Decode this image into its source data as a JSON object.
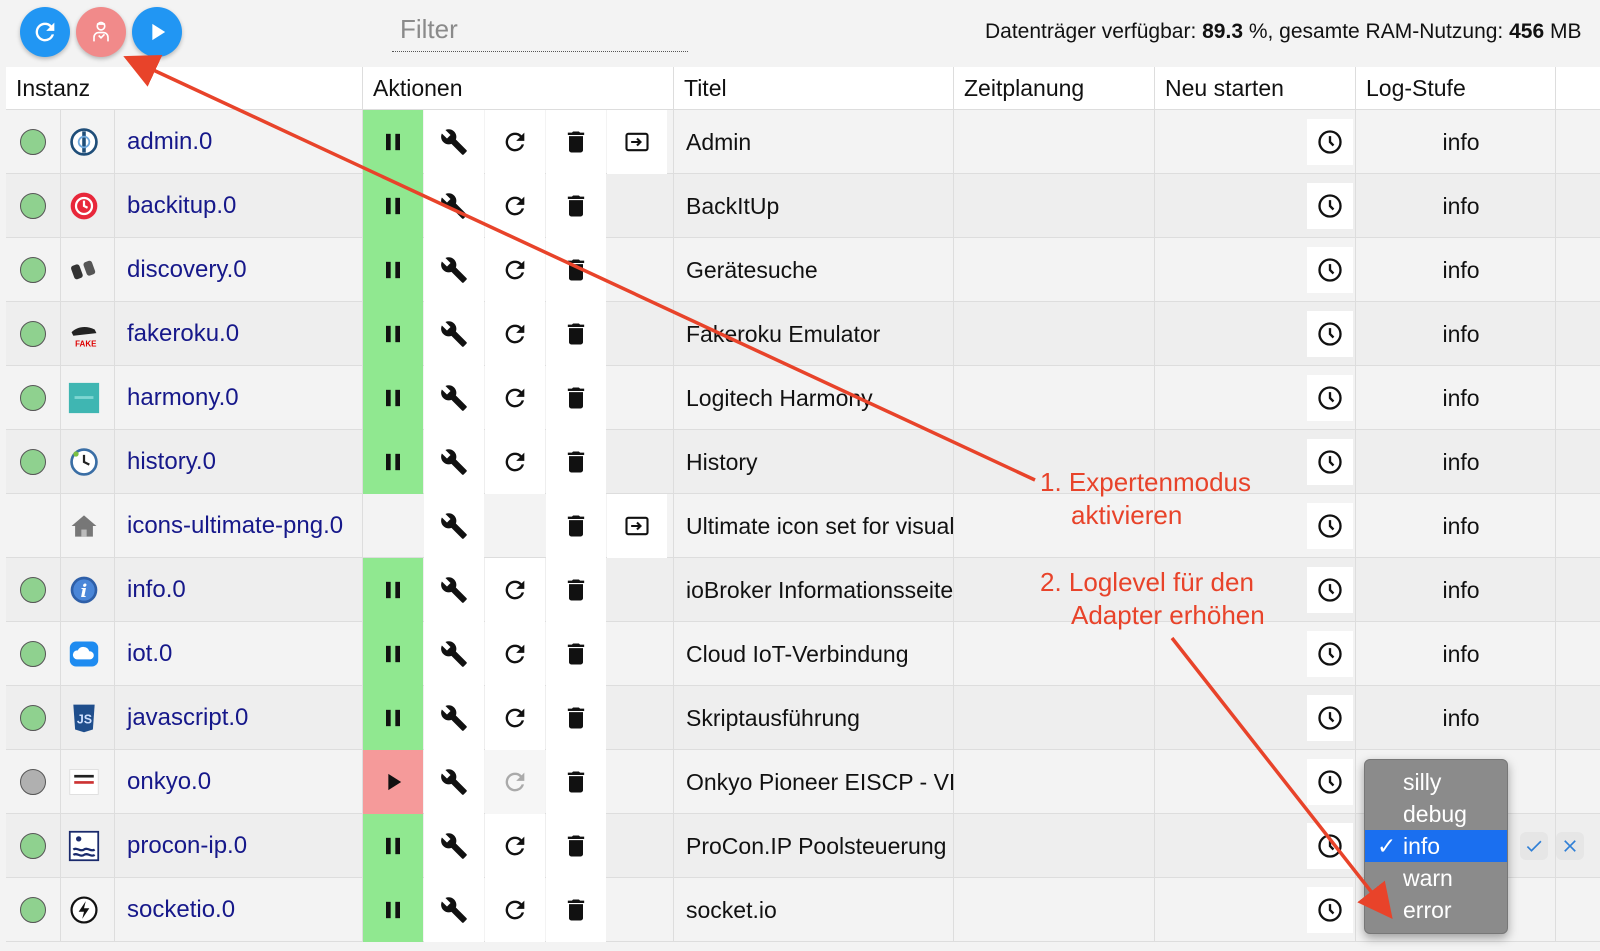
{
  "toolbar": {
    "filter_placeholder": "Filter",
    "status_prefix": "Datenträger verfügbar: ",
    "disk_value": "89.3",
    "status_mid": " %, gesamte RAM-Nutzung: ",
    "ram_value": "456",
    "status_suffix": " MB"
  },
  "columns": [
    "Instanz",
    "Aktionen",
    "Titel",
    "Zeitplanung",
    "Neu starten",
    "Log-Stufe"
  ],
  "rows": [
    {
      "name": "admin.0",
      "title": "Admin",
      "log": "info",
      "status": "green",
      "icon": "admin-icon",
      "play": "pause",
      "restart": true,
      "open": true
    },
    {
      "name": "backitup.0",
      "title": "BackItUp",
      "log": "info",
      "status": "green",
      "icon": "backitup-icon",
      "play": "pause",
      "restart": true,
      "open": false
    },
    {
      "name": "discovery.0",
      "title": "Gerätesuche",
      "log": "info",
      "status": "green",
      "icon": "binoculars-icon",
      "play": "pause",
      "restart": true,
      "open": false
    },
    {
      "name": "fakeroku.0",
      "title": "Fakeroku Emulator",
      "log": "info",
      "status": "green",
      "icon": "fakeroku-icon",
      "play": "pause",
      "restart": true,
      "open": false
    },
    {
      "name": "harmony.0",
      "title": "Logitech Harmony",
      "log": "info",
      "status": "green",
      "icon": "harmony-icon",
      "play": "pause",
      "restart": true,
      "open": false
    },
    {
      "name": "history.0",
      "title": "History",
      "log": "info",
      "status": "green",
      "icon": "history-icon",
      "play": "pause",
      "restart": true,
      "open": false
    },
    {
      "name": "icons-ultimate-png.0",
      "title": "Ultimate icon set for visual",
      "log": "info",
      "status": "none",
      "icon": "house-icon",
      "play": "none",
      "restart": false,
      "open": true
    },
    {
      "name": "info.0",
      "title": "ioBroker Informationsseite",
      "log": "info",
      "status": "green",
      "icon": "info-icon",
      "play": "pause",
      "restart": true,
      "open": false
    },
    {
      "name": "iot.0",
      "title": "Cloud IoT-Verbindung",
      "log": "info",
      "status": "green",
      "icon": "cloud-icon",
      "play": "pause",
      "restart": true,
      "open": false
    },
    {
      "name": "javascript.0",
      "title": "Skriptausführung",
      "log": "info",
      "status": "green",
      "icon": "javascript-icon",
      "play": "pause",
      "restart": true,
      "open": false
    },
    {
      "name": "onkyo.0",
      "title": "Onkyo Pioneer EISCP - VIS",
      "log": "",
      "status": "gray",
      "icon": "onkyo-icon",
      "play": "play",
      "restart": "dim",
      "open": false
    },
    {
      "name": "procon-ip.0",
      "title": "ProCon.IP Poolsteuerung",
      "log": "",
      "status": "green",
      "icon": "pool-icon",
      "play": "pause",
      "restart": true,
      "open": false
    },
    {
      "name": "socketio.0",
      "title": "socket.io",
      "log": "",
      "status": "green",
      "icon": "socketio-icon",
      "play": "pause",
      "restart": true,
      "open": false
    }
  ],
  "loglevel_dropdown": {
    "options": [
      "silly",
      "debug",
      "info",
      "warn",
      "error"
    ],
    "selected": "info",
    "check_mark": "✓"
  },
  "annotations": {
    "step1_line1": "1. Expertenmodus",
    "step1_line2": "aktivieren",
    "step2_line1": "2. Loglevel für den",
    "step2_line2": "Adapter erhöhen",
    "color": "#e8432a"
  },
  "colors": {
    "accent_blue": "#2196f3",
    "expert_pink": "#f18a8a",
    "running_green": "#90e890",
    "stopped_red": "#f59a9a",
    "link_navy": "#16188a"
  }
}
